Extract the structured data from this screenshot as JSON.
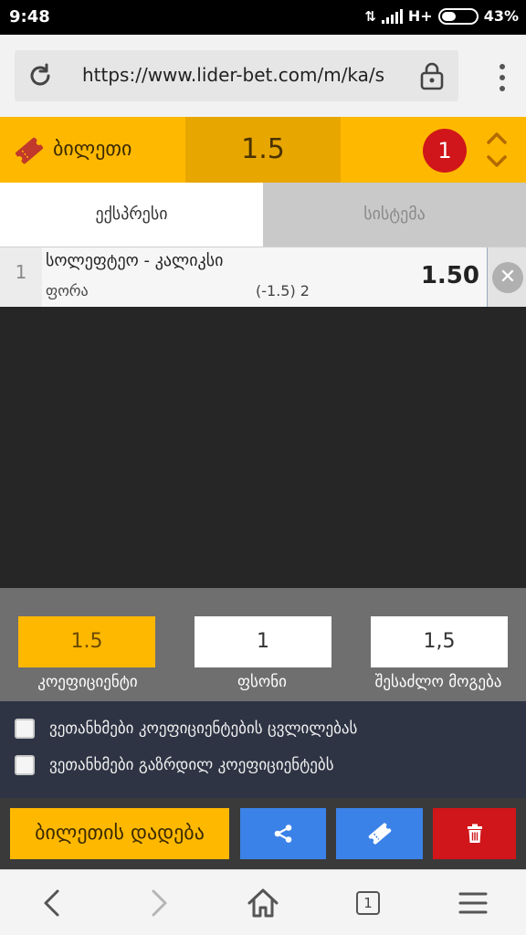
{
  "status_bar": {
    "time": "9:48",
    "network": "H+",
    "battery_percent": "43%",
    "battery_level": 0.43
  },
  "browser": {
    "url": "https://www.lider-bet.com/m/ka/s"
  },
  "ticket": {
    "title": "ბილეთი",
    "total_odds": "1.5",
    "count": "1"
  },
  "tabs": {
    "express": "ექსპრესი",
    "system": "სისტემა",
    "active": "express"
  },
  "bets": [
    {
      "index": "1",
      "match": "სოლეფტეო - კალიკსი",
      "market": "ფორა",
      "line": "(-1.5) 2",
      "odds": "1.50"
    }
  ],
  "summary": {
    "odds_value": "1.5",
    "odds_label": "კოეფიციენტი",
    "stake_value": "1",
    "stake_label": "ფსონი",
    "win_value": "1,5",
    "win_label": "შესაძლო მოგება"
  },
  "agreements": [
    {
      "label": "ვეთანხმები კოეფიციენტების ცვლილებას",
      "checked": false
    },
    {
      "label": "ვეთანხმები გაზრდილ კოეფიციენტებს",
      "checked": false
    }
  ],
  "actions": {
    "place_label": "ბილეთის დადება"
  },
  "bottom_nav": {
    "tabs_count": "1"
  },
  "colors": {
    "accent": "#ffb800",
    "blue": "#3b82e8",
    "red": "#d0161a"
  }
}
